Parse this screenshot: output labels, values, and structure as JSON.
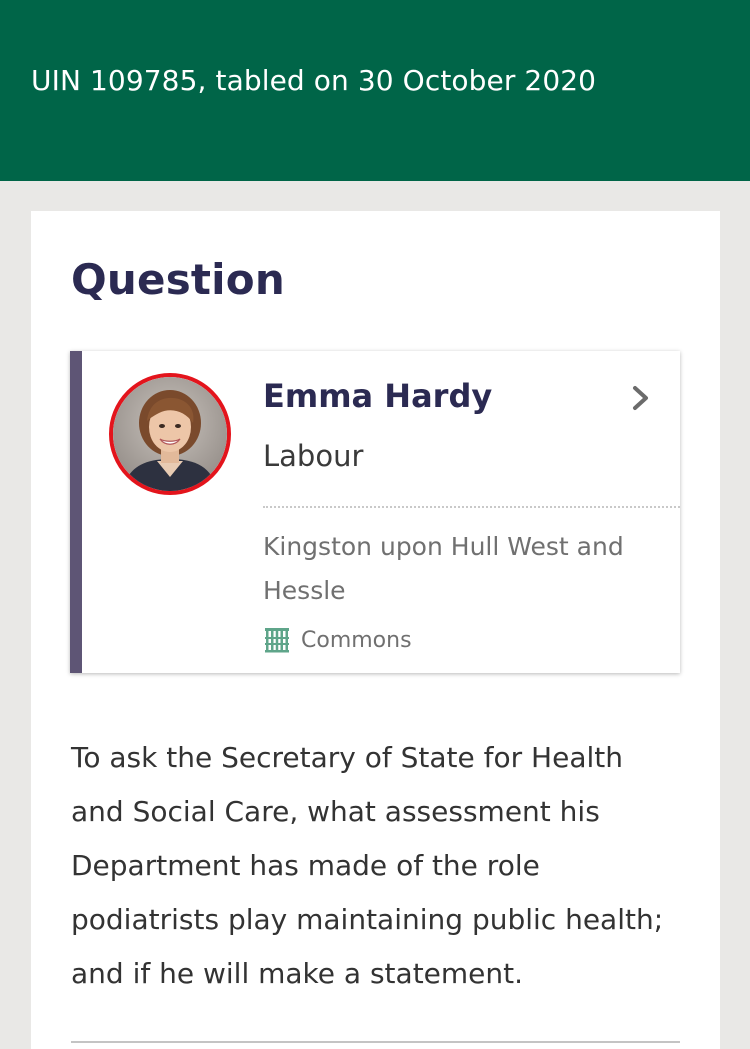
{
  "header": {
    "uin_text": "UIN 109785, tabled on 30 October 2020"
  },
  "question": {
    "title": "Question",
    "body": "To ask the Secretary of State for Health and Social Care, what assessment his Department has made of the role podiatrists play maintaining public health; and if he will make a statement."
  },
  "member": {
    "name": "Emma Hardy",
    "party": "Labour",
    "constituency": "Kingston upon Hull West and Hessle",
    "house": "Commons",
    "avatar_icon": "member-portrait",
    "house_icon": "portcullis-icon",
    "party_color": "#e3141c"
  },
  "colors": {
    "header_bg": "#006548",
    "title_text": "#2b2a52",
    "card_accent": "#5e5575",
    "page_bg": "#e9e8e6",
    "commons_green": "#5fa58a"
  }
}
